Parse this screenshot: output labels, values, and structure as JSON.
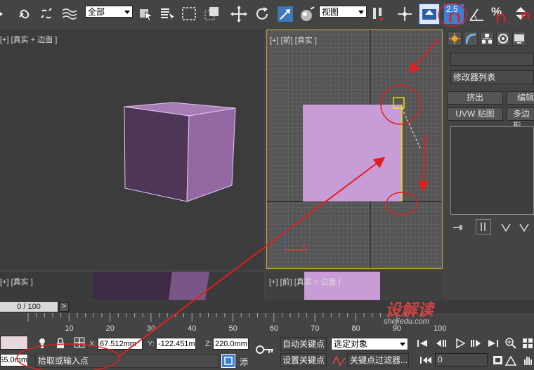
{
  "toolbar": {
    "selection_filter": "全部",
    "ref_coord_system": "视图",
    "snap_value": "2.5",
    "percent_symbol": "%"
  },
  "viewports": {
    "perspective_label": "[+] [真实 + 边面 ]",
    "front_label": "[+] [前] [真实 ]",
    "bottom_left_label": "[+] [真实 ]",
    "bottom_right_label": "[+] [前] [真实 + 边面 ]"
  },
  "command_panel": {
    "modifier_list": "修改器列表",
    "buttons": [
      "挤出",
      "编辑",
      "UVW 贴图",
      "多边形"
    ]
  },
  "timeline": {
    "frame_indicator": "0 / 100",
    "ruler_ticks": [
      "10",
      "20",
      "30",
      "40",
      "50",
      "60",
      "70",
      "80",
      "90",
      "100"
    ]
  },
  "status_bar": {
    "x_label": "X:",
    "x_value": "67.512mm",
    "y_label": "Y:",
    "y_value": "-122.451m",
    "z_label": "Z:",
    "z_value": "220.0mm",
    "left_field": "55.0mm",
    "prompt": "拾取或输入点",
    "add_label": "添",
    "auto_key": "自动关键点",
    "selected_object": "选定对象",
    "set_key": "设置关键点",
    "key_filters": "关键点过滤器...",
    "current_frame": "0"
  },
  "watermark": {
    "text": "设解读",
    "url": "shejiedu.com"
  },
  "colors": {
    "accent": "#c9a23a",
    "object": "#c89cd6",
    "annotation_red": "#e02020",
    "active_blue": "#3f7fd1"
  }
}
